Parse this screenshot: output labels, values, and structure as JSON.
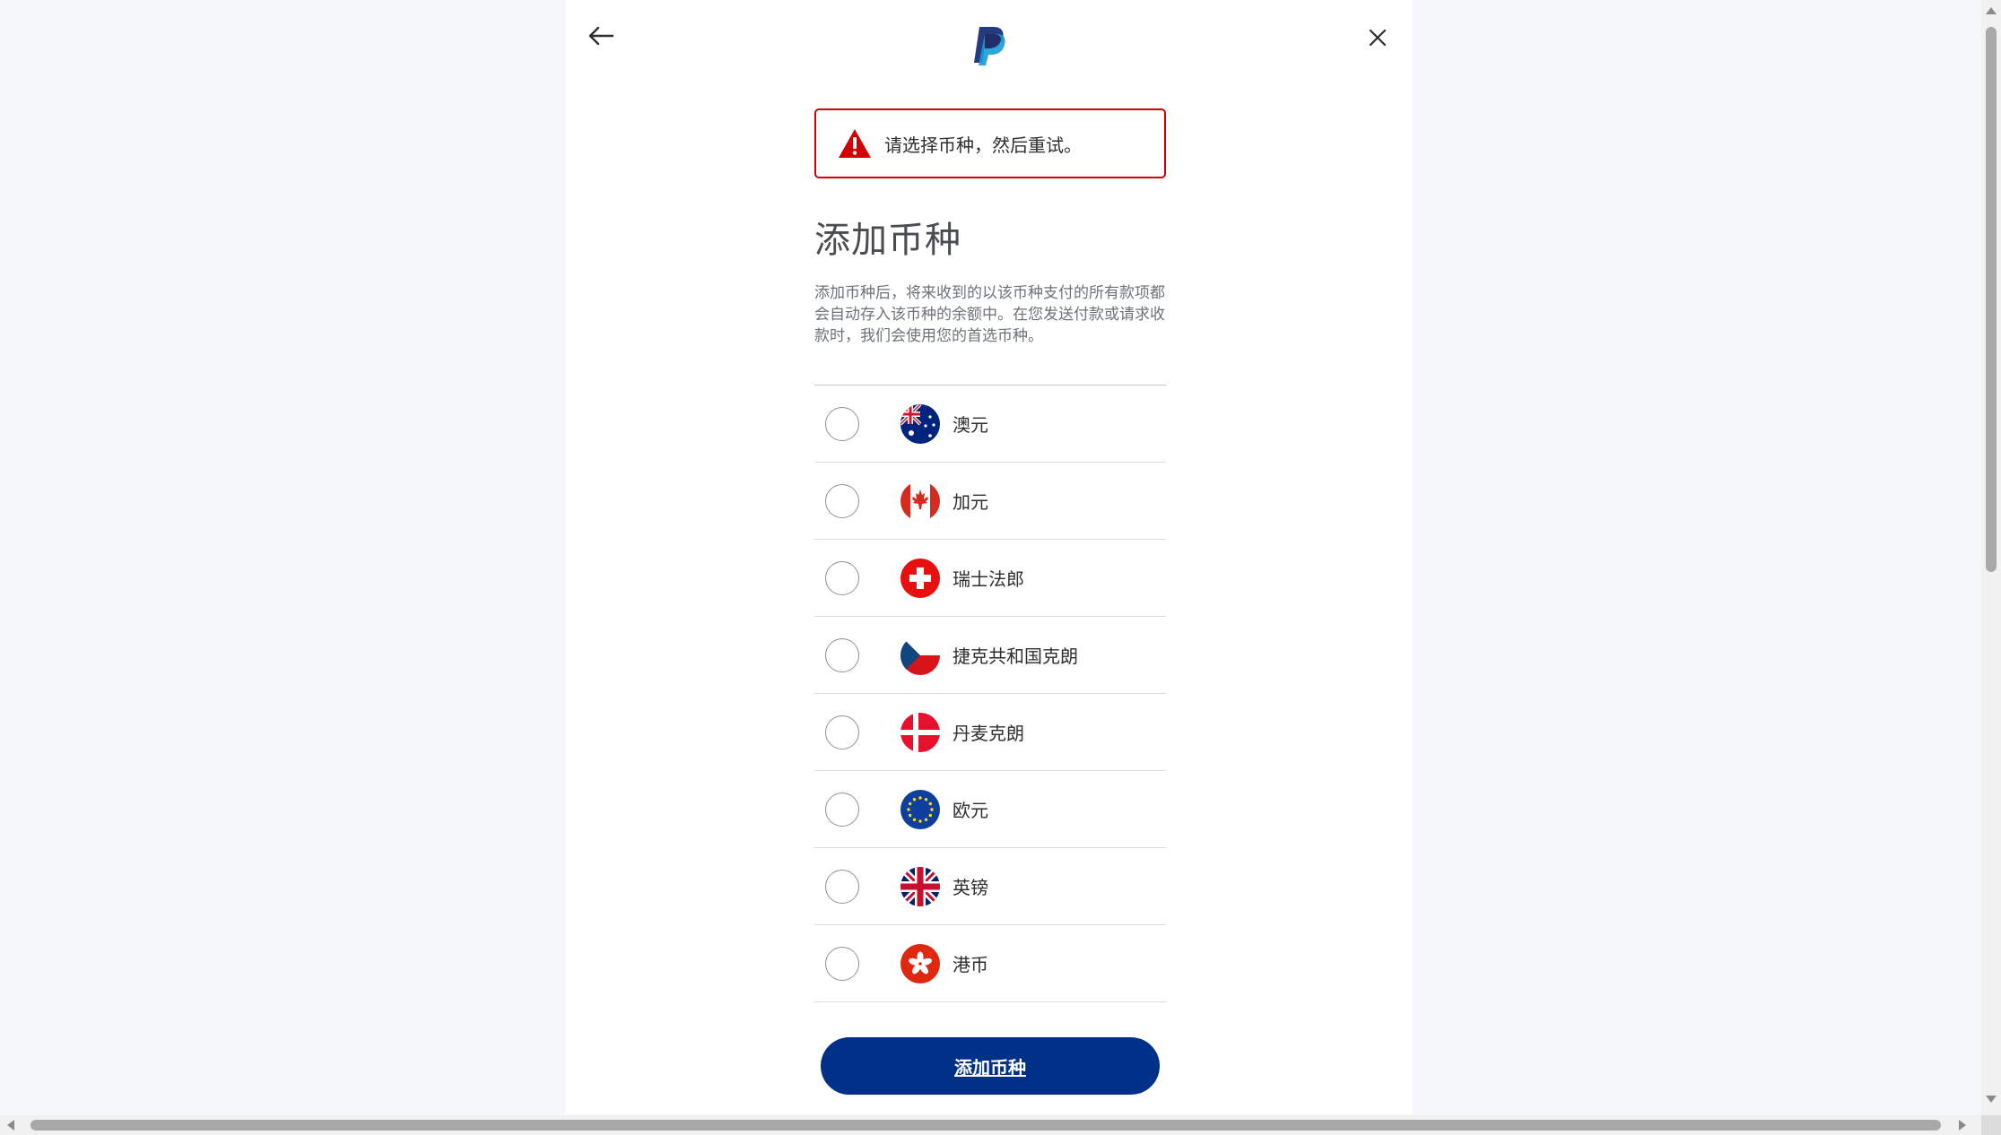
{
  "header": {
    "back_icon": "arrow-left-icon",
    "close_icon": "close-icon",
    "logo": "paypal-logo",
    "brand_colors": {
      "dark_blue": "#253b80",
      "light_blue": "#179bd7"
    }
  },
  "alert": {
    "icon": "warning-triangle-icon",
    "message": "请选择币种，然后重试。",
    "color": "#d20000"
  },
  "title": "添加币种",
  "description": "添加币种后，将来收到的以该币种支付的所有款项都会自动存入该币种的余额中。在您发送付款或请求收款时，我们会使用您的首选币种。",
  "currencies": [
    {
      "label": "澳元",
      "flag": "australia-flag-icon"
    },
    {
      "label": "加元",
      "flag": "canada-flag-icon"
    },
    {
      "label": "瑞士法郎",
      "flag": "switzerland-flag-icon"
    },
    {
      "label": "捷克共和国克朗",
      "flag": "czech-flag-icon"
    },
    {
      "label": "丹麦克朗",
      "flag": "denmark-flag-icon"
    },
    {
      "label": "欧元",
      "flag": "eu-flag-icon"
    },
    {
      "label": "英镑",
      "flag": "uk-flag-icon"
    },
    {
      "label": "港币",
      "flag": "hongkong-flag-icon"
    }
  ],
  "submit_button": {
    "label": "添加币种",
    "color": "#003087"
  }
}
